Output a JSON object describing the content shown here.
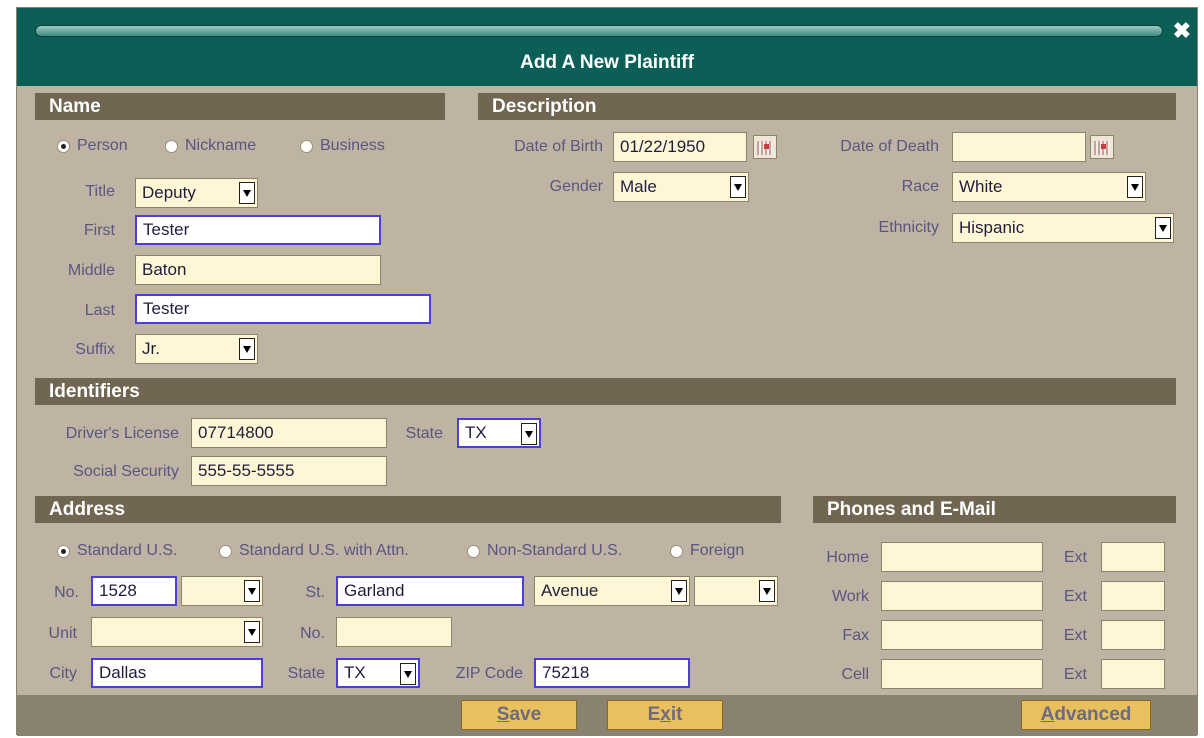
{
  "dialog": {
    "title": "Add A New Plaintiff"
  },
  "sections": {
    "name": "Name",
    "description": "Description",
    "identifiers": "Identifiers",
    "address": "Address",
    "phones": "Phones and E-Mail"
  },
  "name_section": {
    "types": [
      {
        "label": "Person",
        "selected": true
      },
      {
        "label": "Nickname",
        "selected": false
      },
      {
        "label": "Business",
        "selected": false
      }
    ],
    "title_label": "Title",
    "title_value": "Deputy",
    "first_label": "First",
    "first_value": "Tester",
    "middle_label": "Middle",
    "middle_value": "Baton",
    "last_label": "Last",
    "last_value": "Tester",
    "suffix_label": "Suffix",
    "suffix_value": "Jr."
  },
  "description_section": {
    "dob_label": "Date of Birth",
    "dob_value": "01/22/1950",
    "dod_label": "Date of Death",
    "dod_value": "",
    "gender_label": "Gender",
    "gender_value": "Male",
    "race_label": "Race",
    "race_value": "White",
    "ethnicity_label": "Ethnicity",
    "ethnicity_value": "Hispanic"
  },
  "identifiers_section": {
    "dl_label": "Driver's License",
    "dl_value": "07714800",
    "state_label": "State",
    "state_value": "TX",
    "ssn_label": "Social Security",
    "ssn_value": "555-55-5555"
  },
  "address_section": {
    "types": [
      {
        "label": "Standard U.S.",
        "selected": true
      },
      {
        "label": "Standard U.S. with Attn.",
        "selected": false
      },
      {
        "label": "Non-Standard U.S.",
        "selected": false
      },
      {
        "label": "Foreign",
        "selected": false
      }
    ],
    "no_label": "No.",
    "no_value": "1528",
    "prefix_value": "",
    "st_label": "St.",
    "st_value": "Garland",
    "suffix_value": "Avenue",
    "dir_value": "",
    "unit_label": "Unit",
    "unit_value": "",
    "unit_no_label": "No.",
    "unit_no_value": "",
    "city_label": "City",
    "city_value": "Dallas",
    "state_label": "State",
    "state_value": "TX",
    "zip_label": "ZIP Code",
    "zip_value": "75218"
  },
  "phones_section": {
    "rows": [
      {
        "label": "Home",
        "value": "",
        "ext_label": "Ext",
        "ext_value": ""
      },
      {
        "label": "Work",
        "value": "",
        "ext_label": "Ext",
        "ext_value": ""
      },
      {
        "label": "Fax",
        "value": "",
        "ext_label": "Ext",
        "ext_value": ""
      },
      {
        "label": "Cell",
        "value": "",
        "ext_label": "Ext",
        "ext_value": ""
      }
    ]
  },
  "buttons": {
    "save": {
      "label": "Save",
      "accel": "S",
      "rest": "ave"
    },
    "exit": {
      "label": "Exit",
      "accel": "x",
      "pre": "E",
      "rest": "it"
    },
    "advanced": {
      "label": "Advanced",
      "accel": "A",
      "rest": "dvanced"
    }
  },
  "colors": {
    "titlebar": "#0c5f57",
    "section_header": "#706652",
    "dialog_bg": "#bfb3a3",
    "button": "#e8c05e",
    "active_border": "#4c3fd6"
  }
}
